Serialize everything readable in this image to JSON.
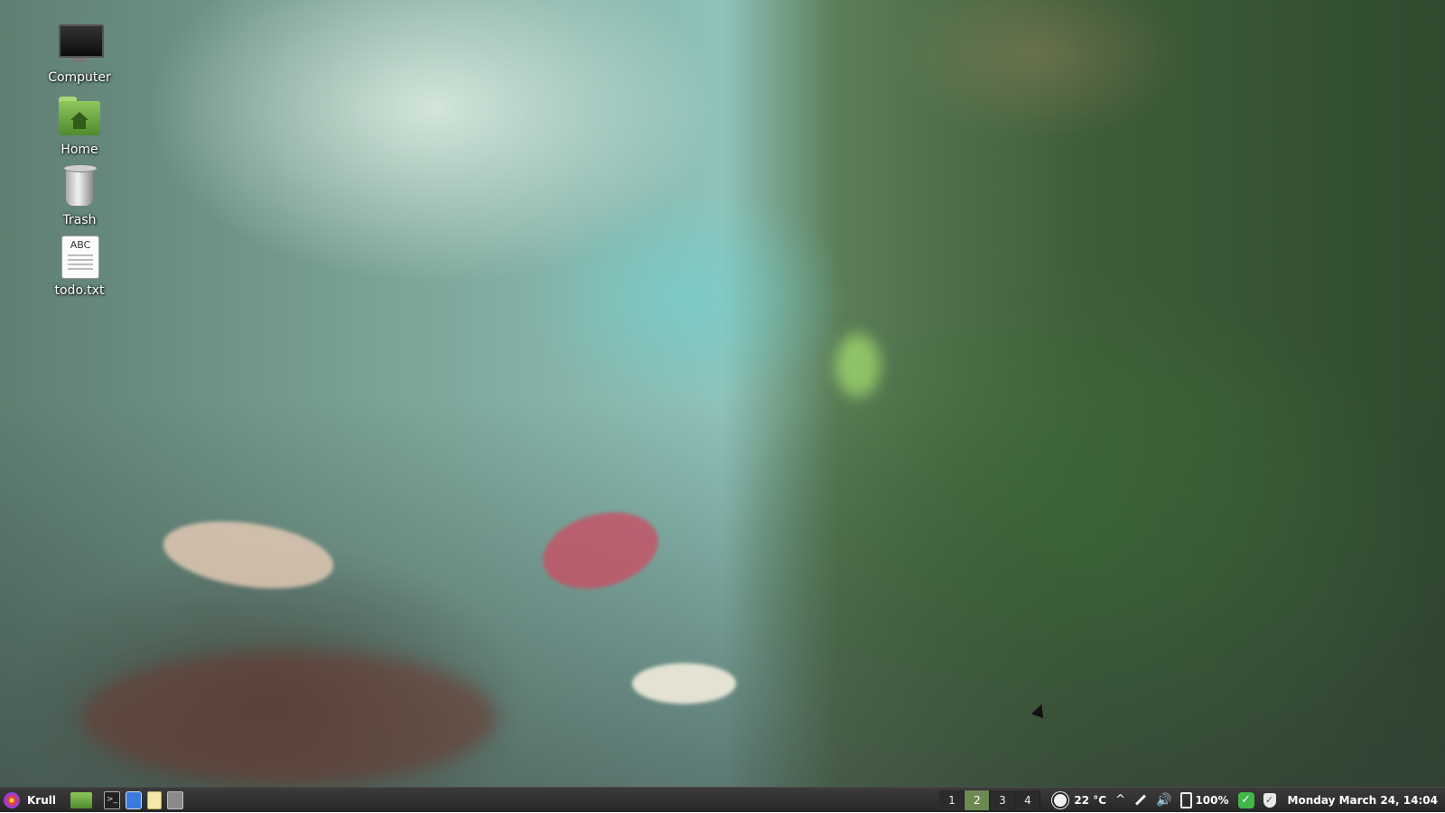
{
  "desktop": {
    "icons": [
      {
        "label": "Computer",
        "icon": "computer-monitor-icon"
      },
      {
        "label": "Home",
        "icon": "home-folder-icon"
      },
      {
        "label": "Trash",
        "icon": "trash-can-icon"
      },
      {
        "label": "todo.txt",
        "icon": "text-file-icon",
        "badge": "ABC"
      }
    ]
  },
  "taskbar": {
    "menu_label": "Krull",
    "launchers": [
      "file-manager-icon",
      "terminal-icon",
      "chromium-browser-icon",
      "text-editor-icon",
      "system-monitor-icon"
    ],
    "workspaces": [
      "1",
      "2",
      "3",
      "4"
    ],
    "active_workspace": "2",
    "weather": {
      "temperature": "22 °C",
      "icon": "sun-icon"
    },
    "battery": {
      "level": "100%"
    },
    "clock": "Monday March 24, 14:04"
  },
  "colors": {
    "panel_bg": "#2f2f2f",
    "workspace_active": "#6b8a53",
    "update_ok": "#43b649"
  }
}
